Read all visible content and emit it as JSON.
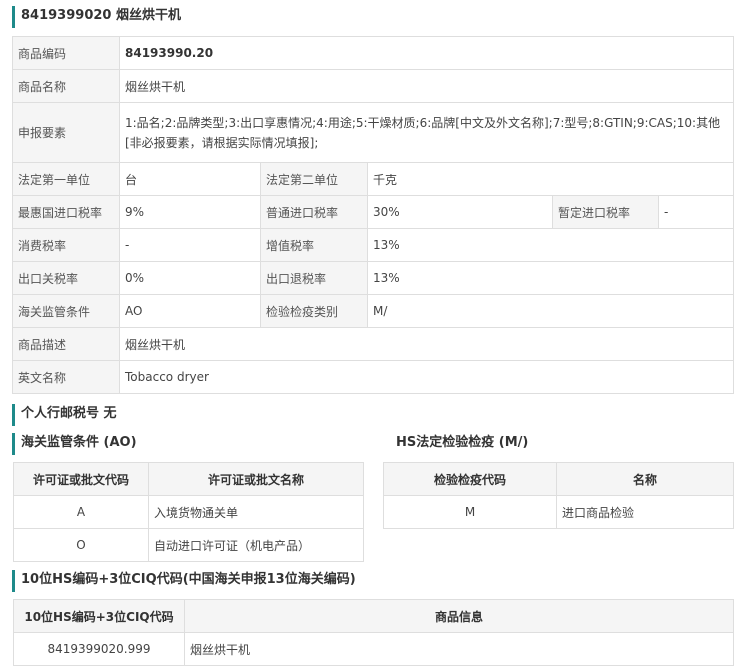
{
  "header": {
    "code": "8419399020",
    "name": "烟丝烘干机"
  },
  "info": {
    "code_label": "商品编码",
    "code_value": "84193990.20",
    "name_label": "商品名称",
    "name_value": "烟丝烘干机",
    "elements_label": "申报要素",
    "elements_value": "1:品名;2:品牌类型;3:出口享惠情况;4:用途;5:干燥材质;6:品牌[中文及外文名称];7:型号;8:GTIN;9:CAS;10:其他[非必报要素，请根据实际情况填报];",
    "unit1_label": "法定第一单位",
    "unit1_value": "台",
    "unit2_label": "法定第二单位",
    "unit2_value": "千克",
    "mfn_label": "最惠国进口税率",
    "mfn_value": "9%",
    "general_label": "普通进口税率",
    "general_value": "30%",
    "provisional_label": "暂定进口税率",
    "provisional_value": "-",
    "consumption_label": "消费税率",
    "consumption_value": "-",
    "vat_label": "增值税率",
    "vat_value": "13%",
    "export_tax_label": "出口关税率",
    "export_tax_value": "0%",
    "export_rebate_label": "出口退税率",
    "export_rebate_value": "13%",
    "customs_label": "海关监管条件",
    "customs_value": "AO",
    "inspection_label": "检验检疫类别",
    "inspection_value": "M/",
    "desc_label": "商品描述",
    "desc_value": "烟丝烘干机",
    "en_label": "英文名称",
    "en_value": "Tobacco dryer"
  },
  "postal": {
    "title": "个人行邮税号 无"
  },
  "customs_conditions": {
    "title": "海关监管条件 (AO)",
    "col1": "许可证或批文代码",
    "col2": "许可证或批文名称",
    "rows": [
      {
        "code": "A",
        "name": "入境货物通关单"
      },
      {
        "code": "O",
        "name": "自动进口许可证（机电产品）"
      }
    ]
  },
  "hs_inspection": {
    "title": "HS法定检验检疫 (M/)",
    "col1": "检验检疫代码",
    "col2": "名称",
    "rows": [
      {
        "code": "M",
        "name": "进口商品检验"
      }
    ]
  },
  "ciq": {
    "title": "10位HS编码+3位CIQ代码(中国海关申报13位海关编码)",
    "col1": "10位HS编码+3位CIQ代码",
    "col2": "商品信息",
    "rows": [
      {
        "code": "8419399020.999",
        "name": "烟丝烘干机"
      }
    ]
  }
}
